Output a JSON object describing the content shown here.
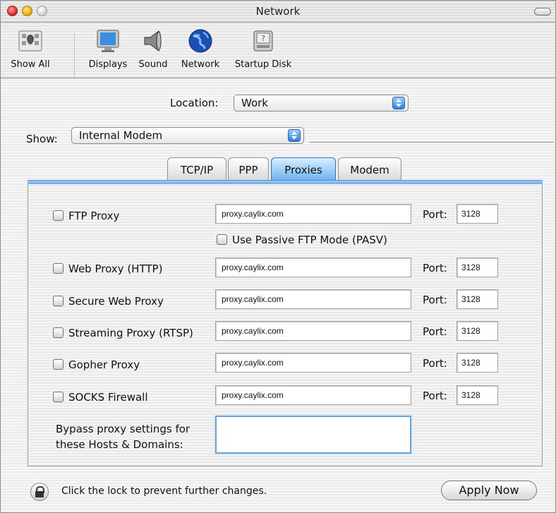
{
  "window": {
    "title": "Network"
  },
  "toolbar": {
    "items": [
      {
        "label": "Show All",
        "icon": "show-all-icon"
      },
      {
        "label": "Displays",
        "icon": "display-icon"
      },
      {
        "label": "Sound",
        "icon": "speaker-icon"
      },
      {
        "label": "Network",
        "icon": "globe-icon"
      },
      {
        "label": "Startup Disk",
        "icon": "disk-icon"
      }
    ]
  },
  "location": {
    "label": "Location:",
    "value": "Work"
  },
  "show": {
    "label": "Show:",
    "value": "Internal Modem"
  },
  "tabs": [
    {
      "label": "TCP/IP",
      "active": false
    },
    {
      "label": "PPP",
      "active": false
    },
    {
      "label": "Proxies",
      "active": true
    },
    {
      "label": "Modem",
      "active": false
    }
  ],
  "proxies": {
    "port_label": "Port:",
    "rows": [
      {
        "label": "FTP Proxy",
        "server": "proxy.caylix.com",
        "port": "3128"
      },
      {
        "label": "Web Proxy (HTTP)",
        "server": "proxy.caylix.com",
        "port": "3128"
      },
      {
        "label": "Secure Web Proxy",
        "server": "proxy.caylix.com",
        "port": "3128"
      },
      {
        "label": "Streaming Proxy (RTSP)",
        "server": "proxy.caylix.com",
        "port": "3128"
      },
      {
        "label": "Gopher Proxy",
        "server": "proxy.caylix.com",
        "port": "3128"
      },
      {
        "label": "SOCKS Firewall",
        "server": "proxy.caylix.com",
        "port": "3128"
      }
    ],
    "passive_ftp_label": "Use Passive FTP Mode (PASV)",
    "bypass_label_line1": "Bypass proxy settings for",
    "bypass_label_line2": "these Hosts & Domains:",
    "bypass_value": ""
  },
  "footer": {
    "lock_text": "Click the lock to prevent further changes.",
    "apply_label": "Apply Now"
  },
  "colors": {
    "accent": "#6aa7e6",
    "tab_active": "#6fb3f0"
  }
}
